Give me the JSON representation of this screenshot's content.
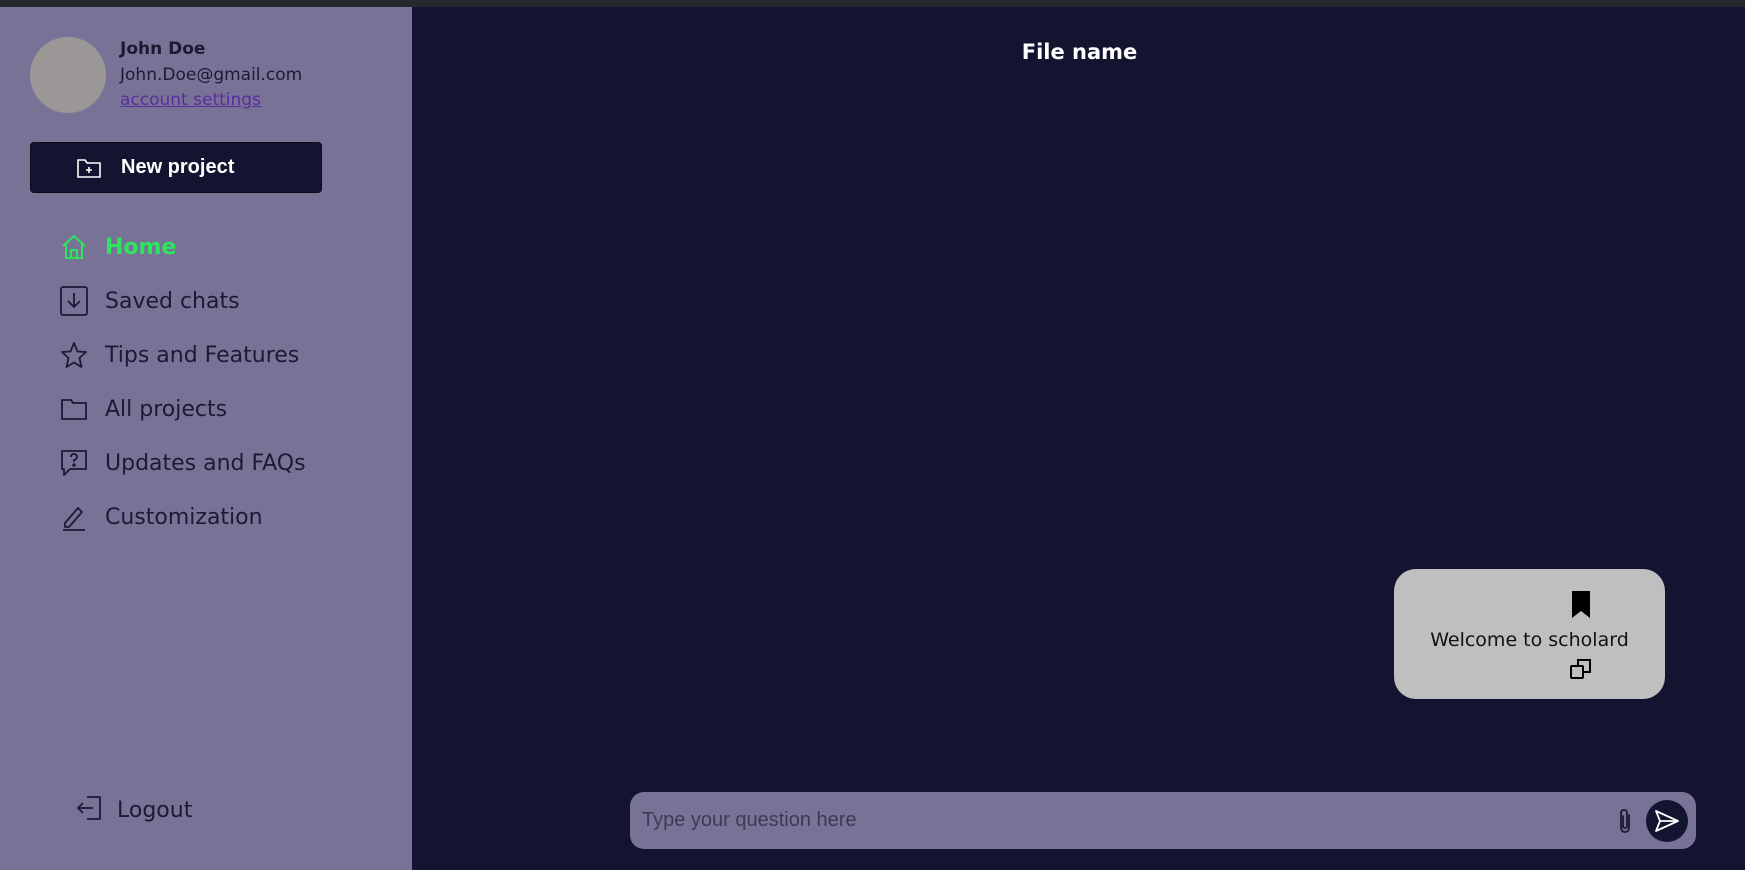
{
  "user": {
    "name": "John Doe",
    "email": "John.Doe@gmail.com",
    "account_link": "account settings"
  },
  "sidebar": {
    "new_project_label": "New project",
    "items": [
      {
        "label": "Home",
        "icon": "home-icon",
        "active": true
      },
      {
        "label": "Saved chats",
        "icon": "download-icon",
        "active": false
      },
      {
        "label": "Tips and Features",
        "icon": "star-icon",
        "active": false
      },
      {
        "label": "All projects",
        "icon": "folder-icon",
        "active": false
      },
      {
        "label": "Updates and FAQs",
        "icon": "question-chat-icon",
        "active": false
      },
      {
        "label": "Customization",
        "icon": "pen-icon",
        "active": false
      }
    ],
    "logout_label": "Logout"
  },
  "main": {
    "file_name": "File name",
    "messages": [
      {
        "text": "Welcome to scholard"
      }
    ],
    "input": {
      "placeholder": "Type your question here",
      "value": ""
    }
  },
  "colors": {
    "sidebar_bg": "#787396",
    "main_bg": "#13142f",
    "active_nav": "#2ee35f",
    "bubble_bg": "#c0bfbf"
  }
}
